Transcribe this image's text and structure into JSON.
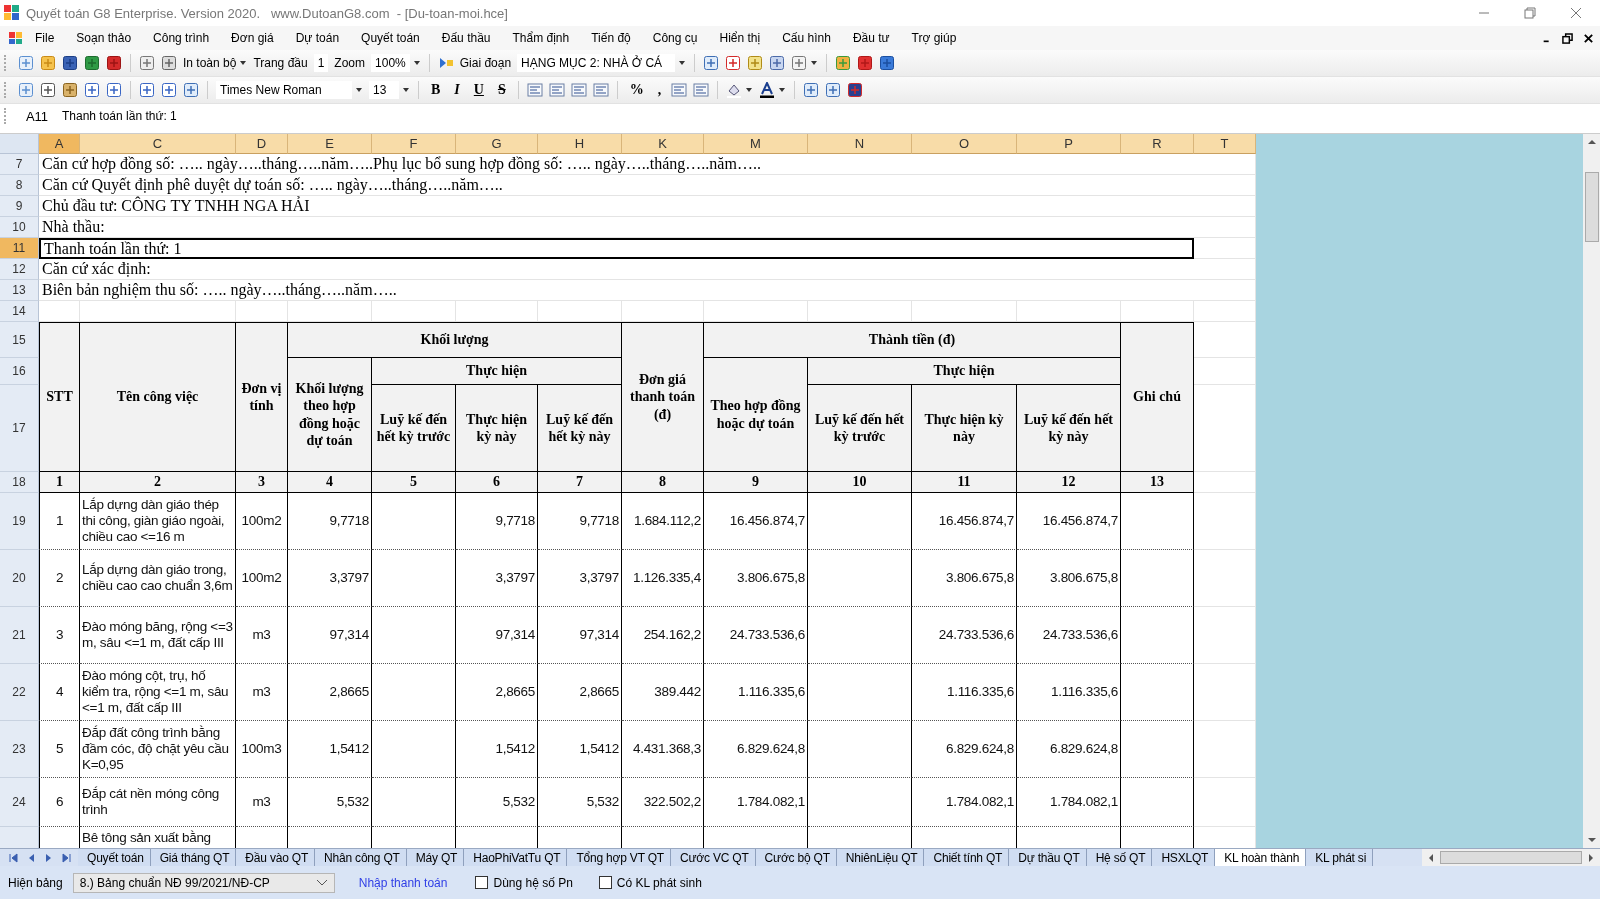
{
  "window": {
    "title": "Quyết toán G8 Enterprise. Version 2020.   www.DutoanG8.com  - [Du-toan-moi.hce]"
  },
  "menu": [
    "File",
    "Soạn thảo",
    "Công trình",
    "Đơn giá",
    "Dự toán",
    "Quyết toán",
    "Đấu thầu",
    "Thẩm định",
    "Tiến độ",
    "Công cụ",
    "Hiển thị",
    "Cấu hình",
    "Đầu tư",
    "Trợ giúp"
  ],
  "toolbar": {
    "print_scope": "In toàn bộ",
    "start_page_label": "Trang đầu",
    "start_page": "1",
    "zoom_label": "Zoom",
    "zoom": "100%",
    "stage_label": "Giai đoạn",
    "stage": "HẠNG MỤC 2: NHÀ Ở CÁ"
  },
  "format_bar": {
    "font": "Times New Roman",
    "size": "13",
    "styles": [
      {
        "kind": "bold",
        "label": "B"
      },
      {
        "kind": "italic",
        "label": "I"
      },
      {
        "kind": "underline",
        "label": "U"
      },
      {
        "kind": "strike",
        "label": "S"
      }
    ],
    "number_formats": [
      "%",
      ","
    ]
  },
  "formula_bar": {
    "cell": "A11",
    "content": "Thanh toán lần thứ: 1"
  },
  "sheet": {
    "columns": [
      {
        "label": "A",
        "selected": true
      },
      {
        "label": "C",
        "selected": false
      },
      {
        "label": "D",
        "selected": false
      },
      {
        "label": "E",
        "selected": false
      },
      {
        "label": "F",
        "selected": false
      },
      {
        "label": "G",
        "selected": false
      },
      {
        "label": "H",
        "selected": false
      },
      {
        "label": "K",
        "selected": false
      },
      {
        "label": "M",
        "selected": false
      },
      {
        "label": "N",
        "selected": false
      },
      {
        "label": "O",
        "selected": false
      },
      {
        "label": "P",
        "selected": false
      },
      {
        "label": "R",
        "selected": false
      },
      {
        "label": "T",
        "selected": false
      }
    ],
    "info_rows": [
      {
        "row": "7",
        "text": "Căn cứ hợp đồng số: ….. ngày…..tháng…..năm…..Phụ lục bổ sung hợp đồng số: ….. ngày…..tháng…..năm…..",
        "selected": false
      },
      {
        "row": "8",
        "text": "Căn cứ Quyết định phê duyệt dự toán số: ….. ngày…..tháng…..năm…..",
        "selected": false
      },
      {
        "row": "9",
        "text": "Chủ đầu tư: CÔNG TY TNHH NGA HẢI",
        "selected": false
      },
      {
        "row": "10",
        "text": "Nhà thầu:",
        "selected": false
      },
      {
        "row": "11",
        "text": "Thanh toán lần thứ: 1",
        "selected": true
      },
      {
        "row": "12",
        "text": "Căn cứ xác định:",
        "selected": false
      },
      {
        "row": "13",
        "text": "Biên bản nghiệm thu số: ….. ngày…..tháng…..năm…..",
        "selected": false
      }
    ],
    "blank_row": "14",
    "header_rows": [
      "15",
      "16",
      "17",
      "18"
    ],
    "header": {
      "stt": "STT",
      "task": "Tên công việc",
      "unit": "Đơn vị tính",
      "quantity": {
        "title": "Khối lượng",
        "contract": "Khối lượng theo hợp đồng hoặc dự toán",
        "done_title": "Thực hiện",
        "done": [
          "Luỹ kế đến hết kỳ trước",
          "Thực hiện kỳ này",
          "Luỹ kế đến hết kỳ này"
        ]
      },
      "unit_price": "Đơn giá thanh toán (đ)",
      "amount": {
        "title": "Thành tiền (đ)",
        "contract": "Theo hợp đồng hoặc dự toán",
        "done_title": "Thực hiện",
        "done": [
          "Luỹ kế đến hết kỳ trước",
          "Thực hiện kỳ này",
          "Luỹ kế đến hết kỳ này"
        ]
      },
      "note": "Ghi chú",
      "numbers": [
        "1",
        "2",
        "3",
        "4",
        "5",
        "6",
        "7",
        "8",
        "9",
        "10",
        "11",
        "12",
        "13"
      ]
    },
    "rows": [
      {
        "row": "19",
        "stt": "1",
        "task": "Lắp dựng dàn giáo thép thi công, giàn giáo ngoài, chiều cao <=16 m",
        "unit": "100m2",
        "values": {
          "E": "9,7718",
          "G": "9,7718",
          "H": "9,7718",
          "K": "1.684.112,2",
          "M": "16.456.874,7",
          "O": "16.456.874,7",
          "P": "16.456.874,7"
        }
      },
      {
        "row": "20",
        "stt": "2",
        "task": "Lắp dựng dàn giáo trong, chiều cao cao chuẩn 3,6m",
        "unit": "100m2",
        "values": {
          "E": "3,3797",
          "G": "3,3797",
          "H": "3,3797",
          "K": "1.126.335,4",
          "M": "3.806.675,8",
          "O": "3.806.675,8",
          "P": "3.806.675,8"
        }
      },
      {
        "row": "21",
        "stt": "3",
        "task": "Đào móng băng, rộng <=3 m, sâu <=1 m, đất cấp III",
        "unit": "m3",
        "values": {
          "E": "97,314",
          "G": "97,314",
          "H": "97,314",
          "K": "254.162,2",
          "M": "24.733.536,6",
          "O": "24.733.536,6",
          "P": "24.733.536,6"
        }
      },
      {
        "row": "22",
        "stt": "4",
        "task": "Đào móng cột, trụ, hố kiểm tra, rộng <=1 m, sâu <=1 m, đất cấp III",
        "unit": "m3",
        "values": {
          "E": "2,8665",
          "G": "2,8665",
          "H": "2,8665",
          "K": "389.442",
          "M": "1.116.335,6",
          "O": "1.116.335,6",
          "P": "1.116.335,6"
        }
      },
      {
        "row": "23",
        "stt": "5",
        "task": "Đắp đất công trình bằng đầm cóc, độ chặt yêu cầu K=0,95",
        "unit": "100m3",
        "values": {
          "E": "1,5412",
          "G": "1,5412",
          "H": "1,5412",
          "K": "4.431.368,3",
          "M": "6.829.624,8",
          "O": "6.829.624,8",
          "P": "6.829.624,8"
        }
      },
      {
        "row": "24",
        "stt": "6",
        "task": "Đắp cát nền móng công trình",
        "unit": "m3",
        "values": {
          "E": "5,532",
          "G": "5,532",
          "H": "5,532",
          "K": "322.502,2",
          "M": "1.784.082,1",
          "O": "1.784.082,1",
          "P": "1.784.082,1"
        }
      }
    ],
    "partial_row": {
      "task": "Bê tông sản xuất bằng"
    }
  },
  "sheet_tabs": [
    {
      "label": "Quyết toán",
      "selected": false
    },
    {
      "label": "Giá tháng QT",
      "selected": false
    },
    {
      "label": "Đầu vào QT",
      "selected": false
    },
    {
      "label": "Nhân công QT",
      "selected": false
    },
    {
      "label": "Máy QT",
      "selected": false
    },
    {
      "label": "HaoPhiVatTu QT",
      "selected": false
    },
    {
      "label": "Tổng hợp VT QT",
      "selected": false
    },
    {
      "label": "Cước VC QT",
      "selected": false
    },
    {
      "label": "Cước bộ QT",
      "selected": false
    },
    {
      "label": "NhiênLiệu QT",
      "selected": false
    },
    {
      "label": "Chiết tính QT",
      "selected": false
    },
    {
      "label": "Dự thầu QT",
      "selected": false
    },
    {
      "label": "Hệ số QT",
      "selected": false
    },
    {
      "label": "HSXLQT",
      "selected": false
    },
    {
      "label": "KL hoàn thành",
      "selected": true
    },
    {
      "label": "KL phát si",
      "selected": false
    }
  ],
  "bottom": {
    "table_label": "Hiện bảng",
    "table_value": "8.) Bảng chuẩn NĐ 99/2021/NĐ-CP",
    "link": "Nhập thanh toán",
    "checkboxes": [
      {
        "label": "Dùng hệ số Pn",
        "checked": false
      },
      {
        "label": "Có KL phát sinh",
        "checked": false
      }
    ]
  }
}
